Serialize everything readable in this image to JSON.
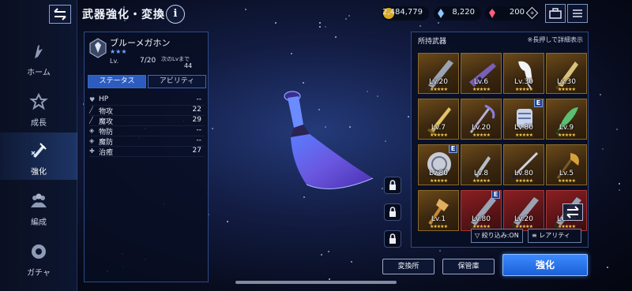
{
  "header": {
    "title": "武器強化・変換",
    "info_label": "i",
    "gold": "2,484,779",
    "crystal": "8,220",
    "gem": "200"
  },
  "nav": {
    "items": [
      {
        "label": "ホーム",
        "icon": "home-icon"
      },
      {
        "label": "成長",
        "icon": "growth-icon"
      },
      {
        "label": "強化",
        "icon": "enhance-icon",
        "active": true
      },
      {
        "label": "編成",
        "icon": "party-icon"
      },
      {
        "label": "ガチャ",
        "icon": "gacha-icon"
      }
    ]
  },
  "weapon": {
    "name": "ブルーメガホン",
    "stars": "★★★",
    "lv_label": "Lv.",
    "lv_value": "7/20",
    "next_lv_label": "次のLvまで",
    "next_lv_value": "44"
  },
  "tabs": {
    "status": "ステータス",
    "ability": "アビリティ"
  },
  "stats": [
    {
      "icon": "heart-icon",
      "glyph": "♥",
      "name": "HP",
      "value": "--"
    },
    {
      "icon": "sword-icon",
      "glyph": "╱",
      "name": "物攻",
      "value": "22"
    },
    {
      "icon": "staff-icon",
      "glyph": "╱",
      "name": "魔攻",
      "value": "29"
    },
    {
      "icon": "shield-icon",
      "glyph": "◈",
      "name": "物防",
      "value": "--"
    },
    {
      "icon": "magic-shield-icon",
      "glyph": "◈",
      "name": "魔防",
      "value": "--"
    },
    {
      "icon": "heal-icon",
      "glyph": "✚",
      "name": "治癒",
      "value": "27"
    }
  ],
  "inventory": {
    "title": "所持武器",
    "hint": "※長押しで詳細表示",
    "stars": "★★★★★",
    "items": [
      {
        "lv": "Lv.20",
        "e": false,
        "red": false,
        "art": "greatsword"
      },
      {
        "lv": "Lv.6",
        "e": false,
        "red": false,
        "art": "rifle"
      },
      {
        "lv": "Lv.30",
        "e": false,
        "red": false,
        "art": "heel"
      },
      {
        "lv": "Lv.30",
        "e": false,
        "red": false,
        "art": "blade"
      },
      {
        "lv": "Lv.7",
        "e": false,
        "red": false,
        "art": "sword"
      },
      {
        "lv": "Lv.20",
        "e": false,
        "red": false,
        "art": "scythe"
      },
      {
        "lv": "Lv.80",
        "e": true,
        "red": false,
        "art": "gauntlet"
      },
      {
        "lv": "Lv.9",
        "e": false,
        "red": false,
        "art": "leafblade"
      },
      {
        "lv": "Lv.80",
        "e": true,
        "red": false,
        "art": "shield"
      },
      {
        "lv": "Lv.8",
        "e": false,
        "red": false,
        "art": "dagger"
      },
      {
        "lv": "Lv.80",
        "e": false,
        "red": false,
        "art": "katana"
      },
      {
        "lv": "Lv.5",
        "e": false,
        "red": false,
        "art": "axe"
      },
      {
        "lv": "Lv.1",
        "e": false,
        "red": false,
        "art": "club"
      },
      {
        "lv": "Lv.80",
        "e": true,
        "red": true,
        "art": "greatsword"
      },
      {
        "lv": "Lv.20",
        "e": false,
        "red": true,
        "art": "greatsword"
      },
      {
        "lv": "Lv.40",
        "e": false,
        "red": true,
        "art": "greatsword"
      }
    ]
  },
  "filter_label": "絞り込み:ON",
  "rarity_label": "レアリティ",
  "buttons": {
    "exchange": "変換所",
    "storage": "保管庫",
    "enhance": "強化"
  }
}
